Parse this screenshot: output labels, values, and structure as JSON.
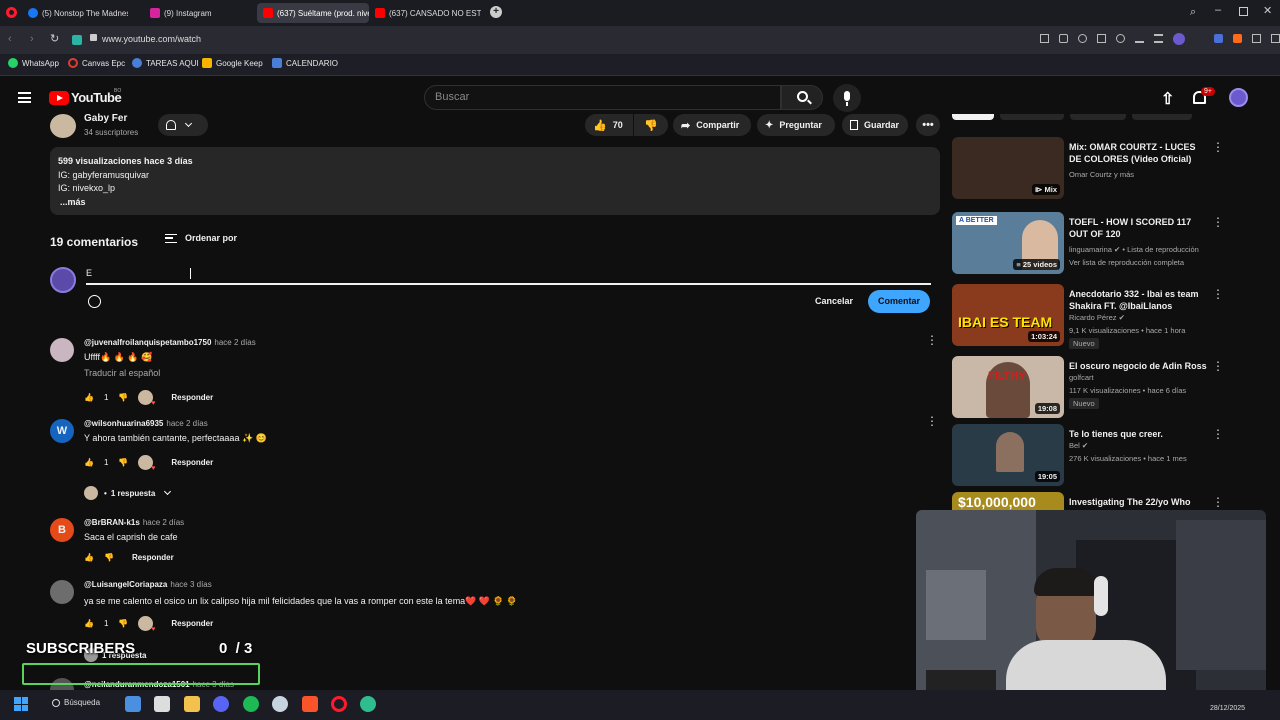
{
  "browser": {
    "tabs": [
      {
        "title": "(5) Nonstop The Madness",
        "color": "#1877f2"
      },
      {
        "title": "(9) Instagram",
        "color": "#d6249f"
      },
      {
        "title": "(637) Suéltame (prod. nive",
        "color": "#ff0000"
      },
      {
        "title": "(637) CANSADO NO ESTO",
        "color": "#ff0000"
      }
    ],
    "url": "www.youtube.com/watch",
    "bookmarks": [
      "WhatsApp",
      "Canvas Epc",
      "TAREAS AQUI",
      "Google Keep",
      "CALENDARIO"
    ]
  },
  "youtube": {
    "logo": "YouTube",
    "country": "BO",
    "search_placeholder": "Buscar",
    "notif_count": "9+"
  },
  "channel": {
    "name": "Gaby Fer",
    "subs": "34 suscriptores"
  },
  "actions": {
    "likes": "70",
    "share": "Compartir",
    "ask": "Preguntar",
    "save": "Guardar"
  },
  "description": {
    "line1": "599 visualizaciones  hace 3 días",
    "line2": "IG: gabyferamusquivar",
    "line3": "IG: nivekxo_lp",
    "more": "...más"
  },
  "comments_header": {
    "count": "19 comentarios",
    "sort": "Ordenar por"
  },
  "comment_box": {
    "value": "E",
    "cancel": "Cancelar",
    "submit": "Comentar"
  },
  "comments": [
    {
      "user": "@juvenalfroilanquispetambo1750",
      "time": "hace 2 días",
      "text": "Uffff🔥 🔥 🔥 🥰",
      "translate": "Traducir al español",
      "likes": "1",
      "reply": "Responder",
      "avatar_color": "#c9b6c0",
      "avatar_letter": ""
    },
    {
      "user": "@wilsonhuarina6935",
      "time": "hace 2 días",
      "text": "Y ahora también cantante, perfectaaaa ✨ 😊",
      "likes": "1",
      "reply": "Responder",
      "replies": "1 respuesta",
      "avatar_color": "#1565c0",
      "avatar_letter": "W"
    },
    {
      "user": "@BrBRAN-k1s",
      "time": "hace 2 días",
      "text": "Saca el caprish de cafe",
      "likes": "",
      "reply": "Responder",
      "avatar_color": "#e64a19",
      "avatar_letter": "B"
    },
    {
      "user": "@LuisangelCoriapaza",
      "time": "hace 3 días",
      "text": "ya se me calento el osico un lix calipso hija mil felicidades que la vas a romper con este la tema❤️ ❤️ 🌻 🌻",
      "likes": "1",
      "reply": "Responder",
      "replies": "1 respuesta",
      "avatar_color": "#6d6d6d",
      "avatar_letter": ""
    },
    {
      "user": "@neilanduranmendoza1501",
      "time": "hace 3 días",
      "text": "",
      "avatar_color": "#555",
      "avatar_letter": ""
    }
  ],
  "recommendations": [
    {
      "title": "Mix: OMAR COURTZ - LUCES DE COLORES (Video Oficial)",
      "meta1": "Omar Courtz y más",
      "meta2": "",
      "badge": "Mix",
      "tag": "",
      "thumb": "#3b2a22"
    },
    {
      "title": "TOEFL - HOW I SCORED 117 OUT OF 120",
      "meta1": "linguamarina ✔ • Lista de reproducción",
      "meta2": "Ver lista de reproducción completa",
      "badge": "25 videos",
      "tag": "",
      "thumb": "#5a7d9a"
    },
    {
      "title": "Anecdotario 332 - Ibai es team Shakira FT. @IbaiLlanos",
      "meta1": "Ricardo Pérez ✔",
      "meta2": "9,1 K visualizaciones • hace 1 hora",
      "badge": "1:03:24",
      "tag": "Nuevo",
      "thumb": "#8a3b1d"
    },
    {
      "title": "El oscuro negocio de Adin Ross",
      "meta1": "golfcart",
      "meta2": "117 K visualizaciones • hace 6 días",
      "badge": "19:08",
      "tag": "Nuevo",
      "thumb": "#c9b7a8"
    },
    {
      "title": "Te lo tienes que creer.",
      "meta1": "Bel ✔",
      "meta2": "276 K visualizaciones • hace 1 mes",
      "badge": "19:05",
      "tag": "",
      "thumb": "#2a3b48"
    },
    {
      "title": "Investigating The 22/yo Who",
      "meta1": "",
      "meta2": "",
      "badge": "",
      "tag": "",
      "thumb": "#a88b1d"
    }
  ],
  "overlay": {
    "subscribers_label": "SUBSCRIBERS",
    "counter": "0  / 3"
  },
  "taskbar": {
    "search": "Búsqueda",
    "date": "28/12/2025"
  }
}
